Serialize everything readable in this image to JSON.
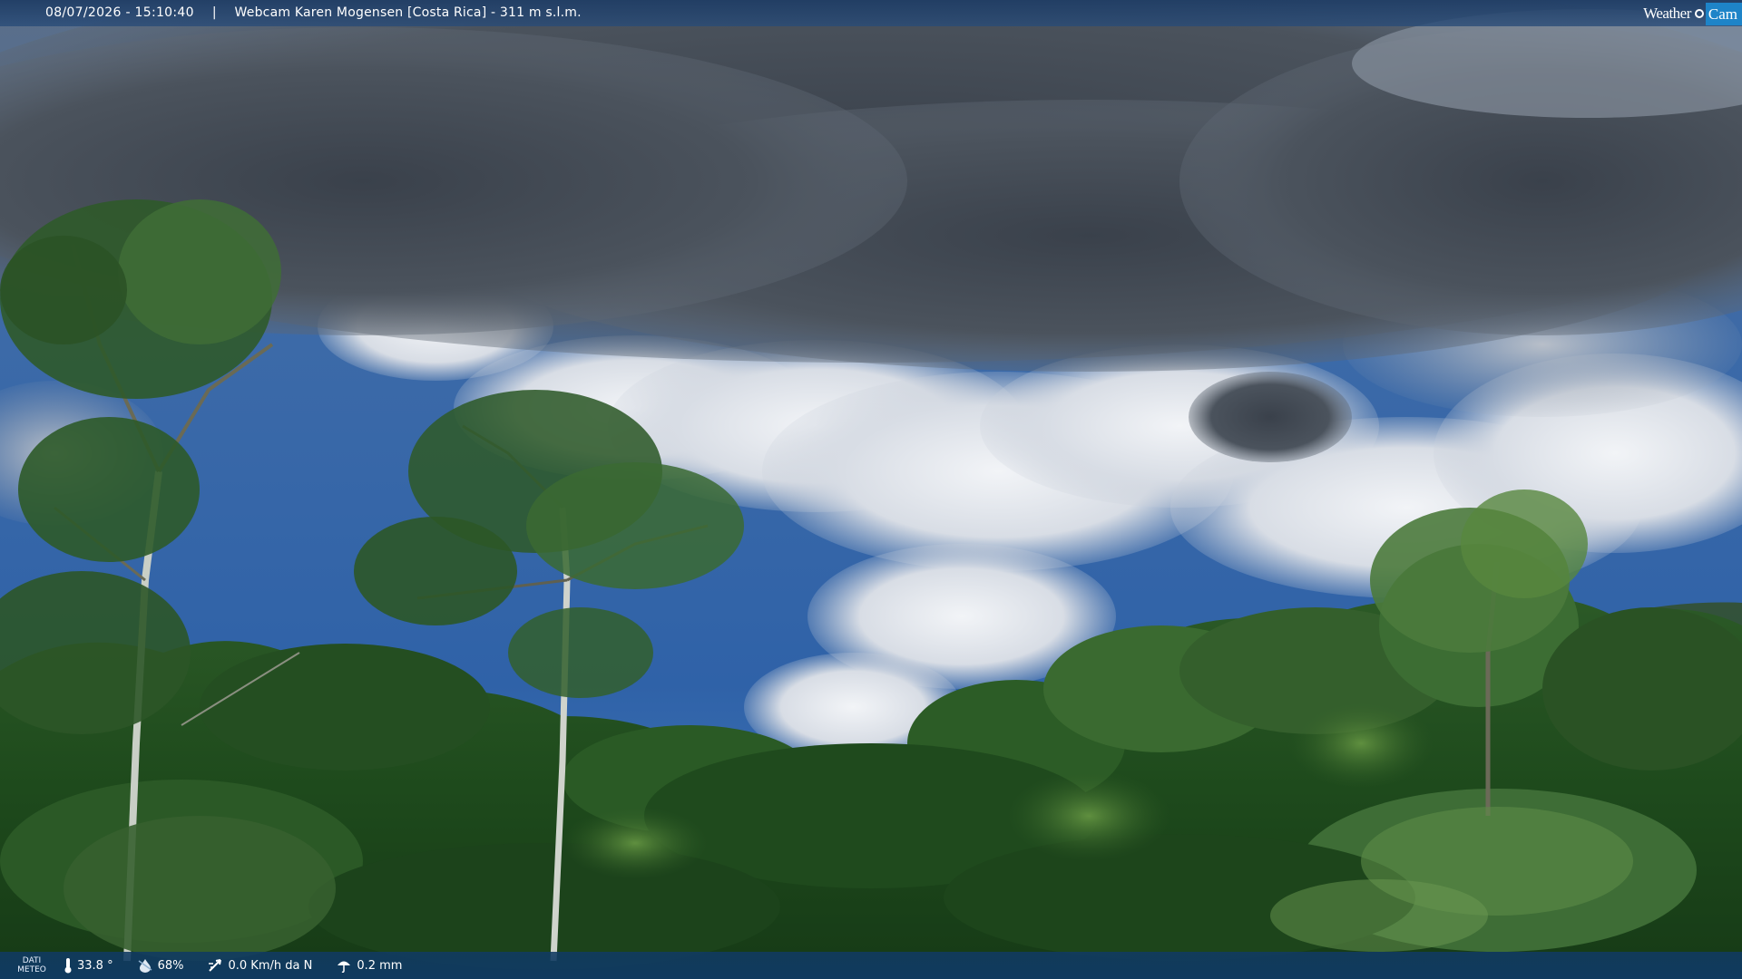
{
  "header": {
    "timestamp": "08/07/2026 - 15:10:40",
    "separator": "|",
    "camera_title": "Webcam Karen Mogensen [Costa Rica] - 311 m s.l.m."
  },
  "logo": {
    "word_left": "Weather",
    "word_right": "Cam",
    "accent_color": "#1e84c8"
  },
  "weather_bar": {
    "label_line1": "DATI",
    "label_line2": "METEO",
    "temperature": "33.8 °",
    "humidity": "68%",
    "wind": "0.0 Km/h da N",
    "rain": "0.2 mm",
    "icons": [
      "thermometer-icon",
      "humidity-icon",
      "wind-icon",
      "rain-icon"
    ]
  },
  "colors": {
    "bar_background": "#103a62",
    "sky_blue": "#3b6fb3",
    "cloud_dark": "#3e4550",
    "foliage": "#1f4a1c"
  }
}
